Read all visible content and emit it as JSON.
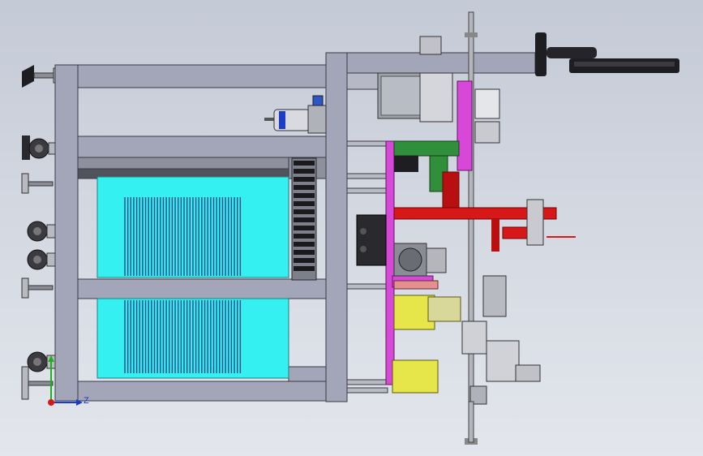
{
  "viewport": {
    "background_top": "#c4cad6",
    "background_bottom": "#e3e6ec"
  },
  "palette": {
    "frame": "#a3a5b8",
    "frame_edge": "#3a3a44",
    "cooling_fill": "#34f0f0",
    "fin": "#2a4a8c",
    "red_rod": "#d81818",
    "magenta_plate": "#d848d8",
    "green_block": "#2f8f3a",
    "yellow_block": "#e6e64a",
    "steel": "#9ea2aa",
    "dark": "#222226"
  },
  "triad": {
    "axis_z_label": "Z",
    "axis_z_color": "#1a3cc8",
    "axis_y_color": "#1fb01f",
    "origin_color": "#d81818",
    "icon": "coordinate-triad-icon"
  },
  "fin_bank_upper_count": 40,
  "fin_bank_lower_count": 40
}
